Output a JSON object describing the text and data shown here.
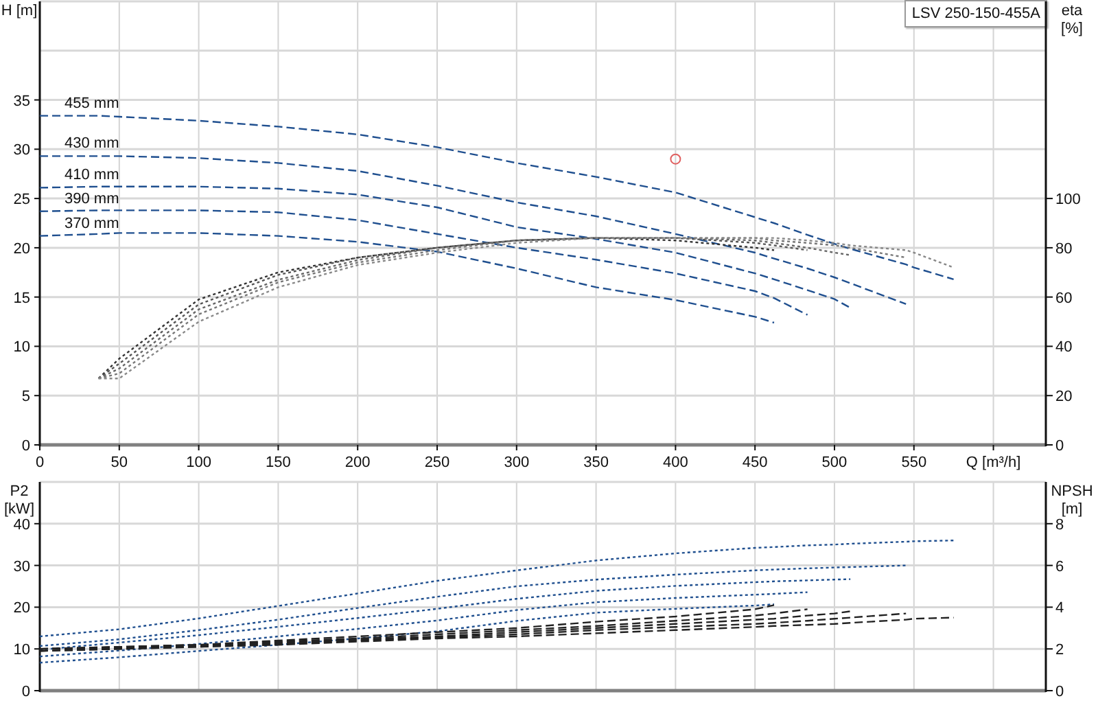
{
  "head_chart": {
    "chart_data": {
      "type": "line",
      "title": "LSV 250-150-455A",
      "ylabel": "H [m]",
      "grid": true,
      "xlim": [
        0,
        633
      ],
      "ylim": [
        0,
        45
      ],
      "xticks": [
        0,
        50,
        100,
        150,
        200,
        250,
        300,
        350,
        400,
        450,
        500,
        550,
        {
          "value": 600,
          "label": "Q [m³/h]"
        }
      ],
      "yticks": [
        0,
        5,
        10,
        15,
        20,
        25,
        30,
        35
      ],
      "x": [
        0,
        37,
        50,
        100,
        150,
        200,
        250,
        300,
        350,
        400,
        450,
        462,
        483,
        500,
        510,
        545,
        550,
        575
      ],
      "series": [
        {
          "name": "455 mm",
          "line_style": "dashed",
          "color": "#1f4f8f",
          "values": [
            33.4,
            33.4,
            33.3,
            32.9,
            32.3,
            31.5,
            30.2,
            28.6,
            27.2,
            25.6,
            23.1,
            22.5,
            21.3,
            20.4,
            19.9,
            18.3,
            18.0,
            16.8
          ]
        },
        {
          "name": "430 mm",
          "line_style": "dashed",
          "color": "#1f4f8f",
          "values": [
            29.3,
            29.3,
            29.3,
            29.1,
            28.6,
            27.8,
            26.3,
            24.6,
            23.2,
            21.4,
            19.5,
            18.9,
            17.9,
            17.0,
            16.4,
            14.3,
            null,
            null
          ]
        },
        {
          "name": "410 mm",
          "line_style": "dashed",
          "color": "#1f4f8f",
          "values": [
            26.1,
            26.2,
            26.2,
            26.2,
            26.0,
            25.4,
            24.1,
            22.1,
            20.9,
            19.5,
            17.4,
            16.8,
            15.7,
            14.8,
            13.9,
            null,
            null,
            null
          ]
        },
        {
          "name": "390 mm",
          "line_style": "dashed",
          "color": "#1f4f8f",
          "values": [
            23.7,
            23.8,
            23.8,
            23.8,
            23.6,
            22.8,
            21.4,
            20.0,
            18.8,
            17.4,
            15.6,
            14.9,
            13.2,
            null,
            null,
            null,
            null,
            null
          ]
        },
        {
          "name": "370 mm",
          "line_style": "dashed",
          "color": "#1f4f8f",
          "values": [
            21.2,
            21.4,
            21.5,
            21.5,
            21.2,
            20.6,
            19.6,
            17.9,
            16.0,
            14.7,
            13.0,
            12.4,
            null,
            null,
            null,
            null,
            null,
            null
          ]
        },
        {
          "color": "#e06060",
          "marker": "circle",
          "values": [
            null,
            null,
            null,
            null,
            null,
            null,
            null,
            null,
            null,
            29,
            null,
            null,
            null,
            null,
            null,
            null,
            null,
            null
          ]
        }
      ]
    }
  },
  "efficiency_chart": {
    "chart_data": {
      "type": "line",
      "ylabel": "eta [%]",
      "xlim": [
        0,
        633
      ],
      "ylim": [
        0,
        180
      ],
      "yticks": [
        0,
        20,
        40,
        60,
        80,
        100
      ],
      "x": [
        37,
        50,
        100,
        150,
        200,
        250,
        300,
        350,
        400,
        450,
        462,
        483,
        500,
        510,
        545,
        550,
        575
      ],
      "series": [
        {
          "line_style": "dotted",
          "color": "#333333",
          "values": [
            27,
            35,
            59,
            70,
            76,
            80,
            83,
            84,
            83,
            80,
            79,
            null,
            null,
            null,
            null,
            null,
            null
          ]
        },
        {
          "line_style": "dotted",
          "color": "#555555",
          "values": [
            27,
            33,
            57,
            69,
            76,
            80,
            83,
            84,
            84,
            82,
            81,
            79,
            null,
            null,
            null,
            null,
            null
          ]
        },
        {
          "line_style": "dotted",
          "color": "#666666",
          "values": [
            27,
            31,
            55,
            67,
            75,
            80,
            83,
            84,
            84,
            83,
            82,
            80,
            78,
            77,
            null,
            null,
            null
          ]
        },
        {
          "line_style": "dotted",
          "color": "#777777",
          "values": [
            27,
            29,
            53,
            66,
            74,
            79,
            83,
            84,
            84,
            84,
            83,
            82,
            81,
            80,
            76,
            null,
            null
          ]
        },
        {
          "line_style": "dotted",
          "color": "#888888",
          "values": [
            27,
            27,
            50,
            64,
            73,
            78,
            82,
            84,
            84,
            84,
            84,
            83,
            82,
            81,
            79,
            78,
            72
          ]
        }
      ]
    }
  },
  "power_chart": {
    "chart_data": {
      "type": "line",
      "ylabel": "P2 [kW]",
      "grid": true,
      "xlim": [
        0,
        633
      ],
      "ylim": [
        0,
        50
      ],
      "yticks": [
        0,
        10,
        20,
        30,
        40
      ],
      "x": [
        0,
        50,
        100,
        150,
        200,
        250,
        300,
        350,
        400,
        450,
        462,
        483,
        500,
        510,
        545,
        550,
        575
      ],
      "series": [
        {
          "line_style": "dotted",
          "color": "#1f4f8f",
          "values": [
            13,
            14.7,
            17.3,
            20.3,
            23.3,
            26.3,
            28.8,
            31.2,
            32.9,
            34.2,
            34.4,
            34.8,
            35.0,
            35.2,
            35.7,
            35.8,
            36.0
          ]
        },
        {
          "line_style": "dotted",
          "color": "#1f4f8f",
          "values": [
            10.7,
            12.3,
            14.5,
            17.0,
            19.8,
            22.5,
            25.0,
            26.6,
            27.8,
            28.8,
            29.0,
            29.3,
            29.5,
            29.6,
            30.0,
            null,
            null
          ]
        },
        {
          "line_style": "dotted",
          "color": "#1f4f8f",
          "values": [
            9.8,
            11.5,
            13.3,
            15.3,
            17.4,
            19.6,
            22.0,
            23.9,
            25.1,
            26.0,
            26.2,
            26.4,
            26.6,
            26.7,
            null,
            null,
            null
          ]
        },
        {
          "line_style": "dotted",
          "color": "#1f4f8f",
          "values": [
            8.2,
            9.6,
            11.2,
            13.0,
            14.8,
            16.8,
            19.3,
            21.2,
            22.2,
            23.0,
            23.2,
            23.6,
            null,
            null,
            null,
            null,
            null
          ]
        },
        {
          "line_style": "dotted",
          "color": "#1f4f8f",
          "values": [
            6.7,
            8.0,
            9.5,
            11.0,
            12.5,
            14.2,
            16.7,
            18.7,
            19.6,
            20.4,
            20.7,
            null,
            null,
            null,
            null,
            null,
            null
          ]
        }
      ]
    }
  },
  "npsh_chart": {
    "chart_data": {
      "type": "line",
      "ylabel": "NPSH [m]",
      "xlim": [
        0,
        633
      ],
      "ylim": [
        0,
        10
      ],
      "yticks": [
        0,
        2,
        4,
        6,
        8
      ],
      "x": [
        0,
        50,
        100,
        150,
        200,
        250,
        300,
        350,
        400,
        450,
        462,
        483,
        500,
        510,
        545,
        550,
        575
      ],
      "series": [
        {
          "line_style": "dashed",
          "color": "#222222",
          "values": [
            1.9,
            2.0,
            2.1,
            2.2,
            2.35,
            2.5,
            2.6,
            2.75,
            2.9,
            3.05,
            3.1,
            3.15,
            3.2,
            3.25,
            3.4,
            3.45,
            3.5
          ]
        },
        {
          "line_style": "dashed",
          "color": "#222222",
          "values": [
            1.9,
            2.0,
            2.1,
            2.25,
            2.4,
            2.55,
            2.7,
            2.9,
            3.05,
            3.2,
            3.25,
            3.35,
            3.45,
            3.5,
            3.7,
            null,
            null
          ]
        },
        {
          "line_style": "dashed",
          "color": "#222222",
          "values": [
            2.0,
            2.05,
            2.15,
            2.3,
            2.45,
            2.6,
            2.8,
            3.0,
            3.2,
            3.4,
            3.45,
            3.6,
            3.7,
            3.8,
            null,
            null,
            null
          ]
        },
        {
          "line_style": "dashed",
          "color": "#222222",
          "values": [
            2.0,
            2.1,
            2.2,
            2.35,
            2.5,
            2.7,
            2.9,
            3.1,
            3.35,
            3.6,
            3.7,
            3.9,
            null,
            null,
            null,
            null,
            null
          ]
        },
        {
          "line_style": "dashed",
          "color": "#222222",
          "values": [
            2.0,
            2.1,
            2.2,
            2.4,
            2.6,
            2.8,
            3.0,
            3.3,
            3.55,
            3.9,
            4.1,
            null,
            null,
            null,
            null,
            null,
            null
          ]
        }
      ]
    }
  }
}
